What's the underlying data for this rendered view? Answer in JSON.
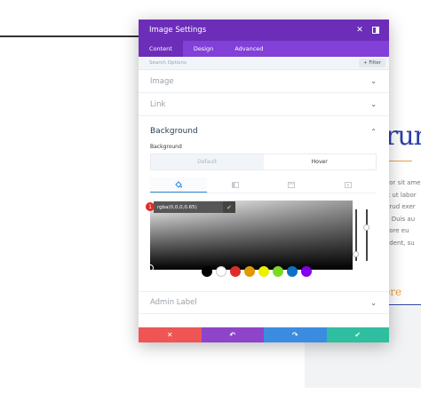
{
  "modal": {
    "title": "Image Settings",
    "tabs": [
      {
        "label": "Content",
        "active": true
      },
      {
        "label": "Design",
        "active": false
      },
      {
        "label": "Advanced",
        "active": false
      }
    ],
    "search_placeholder": "Search Options",
    "filter_label": "+ Filter",
    "sections": {
      "image": "Image",
      "link": "Link",
      "background": "Background",
      "admin_label": "Admin Label"
    },
    "background": {
      "field_label": "Background",
      "toggle": {
        "default": "Default",
        "hover": "Hover",
        "active": "hover"
      },
      "color_value": "rgba(0,0,0,0.65)",
      "badge": "1",
      "swatches": [
        "#000000",
        "#ffffff",
        "#e02b2b",
        "#e09900",
        "#edf000",
        "#7cda24",
        "#0c71c3",
        "#8300e9"
      ]
    },
    "footer": {
      "colors": [
        "#ef5555",
        "#8e44c9",
        "#3b8ce0",
        "#2fbfa0"
      ]
    }
  },
  "background_page": {
    "heading": "rum",
    "paragraph": [
      "olor sit ame",
      "nt ut labor",
      "strud exer",
      "e. Duis au",
      "olore eu",
      "oident, su"
    ],
    "link": "ore"
  }
}
